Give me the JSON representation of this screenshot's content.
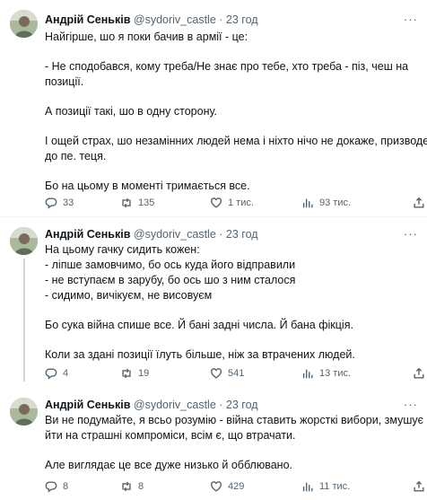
{
  "posts": [
    {
      "author": "Андрій Сеньків",
      "handle": "@sydoriv_castle",
      "separator": "·",
      "time": "23 год",
      "more": "···",
      "lines": [
        "Найгірше, шо я поки бачив в армії - це:",
        "",
        "- Не сподобався, кому треба/Не знає про тебе, хто треба - піз, чеш на",
        "позиції.",
        "",
        "А позиції такі, шо в одну сторону.",
        "",
        "І ощей страх, шо незамінних людей нема і ніхто нічо не докаже, призводе",
        "до пе. теця.",
        "",
        "Бо на цьому в моменті тримається все."
      ],
      "replies": "33",
      "reposts": "135",
      "likes": "1 тис.",
      "views": "93 тис."
    },
    {
      "author": "Андрій Сеньків",
      "handle": "@sydoriv_castle",
      "separator": "·",
      "time": "23 год",
      "more": "···",
      "lines": [
        "На цьому гачку сидить кожен:",
        "- ліпше замовчимо, бо ось куда його відправили",
        "- не вступаєм в зарубу, бо ось шо з ним сталося",
        "- сидимо, вичікуєм, не висовуєм",
        "",
        "Бо сука війна спише все. Й  бані задні числа. Й  бана фікція.",
        "",
        "Коли за здані позиції їлуть більше, ніж за втрачених людей."
      ],
      "replies": "4",
      "reposts": "19",
      "likes": "541",
      "views": "13 тис."
    },
    {
      "author": "Андрій Сеньків",
      "handle": "@sydoriv_castle",
      "separator": "·",
      "time": "23 год",
      "more": "···",
      "lines": [
        "Ви не подумайте, я всьо розумію - війна ставить жорсткі вибори, змушує",
        "йти на страшні компроміси, всім є, що втрачати.",
        "",
        "Але виглядає це все дуже низько й обблювано."
      ],
      "replies": "8",
      "reposts": "8",
      "likes": "429",
      "views": "11 тис."
    }
  ]
}
